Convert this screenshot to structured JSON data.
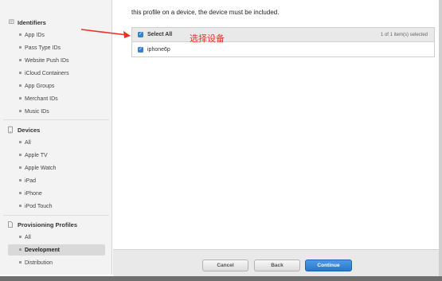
{
  "sidebar": {
    "identifiers": {
      "title": "Identifiers",
      "items": [
        "App IDs",
        "Pass Type IDs",
        "Website Push IDs",
        "iCloud Containers",
        "App Groups",
        "Merchant IDs",
        "Music IDs"
      ]
    },
    "devices": {
      "title": "Devices",
      "items": [
        "All",
        "Apple TV",
        "Apple Watch",
        "iPad",
        "iPhone",
        "iPod Touch"
      ]
    },
    "profiles": {
      "title": "Provisioning Profiles",
      "items": [
        "All",
        "Development",
        "Distribution"
      ],
      "active": "Development"
    }
  },
  "main": {
    "intro": "this profile on a device, the device must be included.",
    "table": {
      "select_all_label": "Select All",
      "count_text": "1   of 1 item(s) selected",
      "rows": [
        {
          "label": "iphone6p",
          "checked": true
        }
      ]
    },
    "annotation": "选择设备",
    "annotation_color": "#e8332a"
  },
  "footer": {
    "cancel_label": "Cancel",
    "back_label": "Back",
    "continue_label": "Continue"
  }
}
